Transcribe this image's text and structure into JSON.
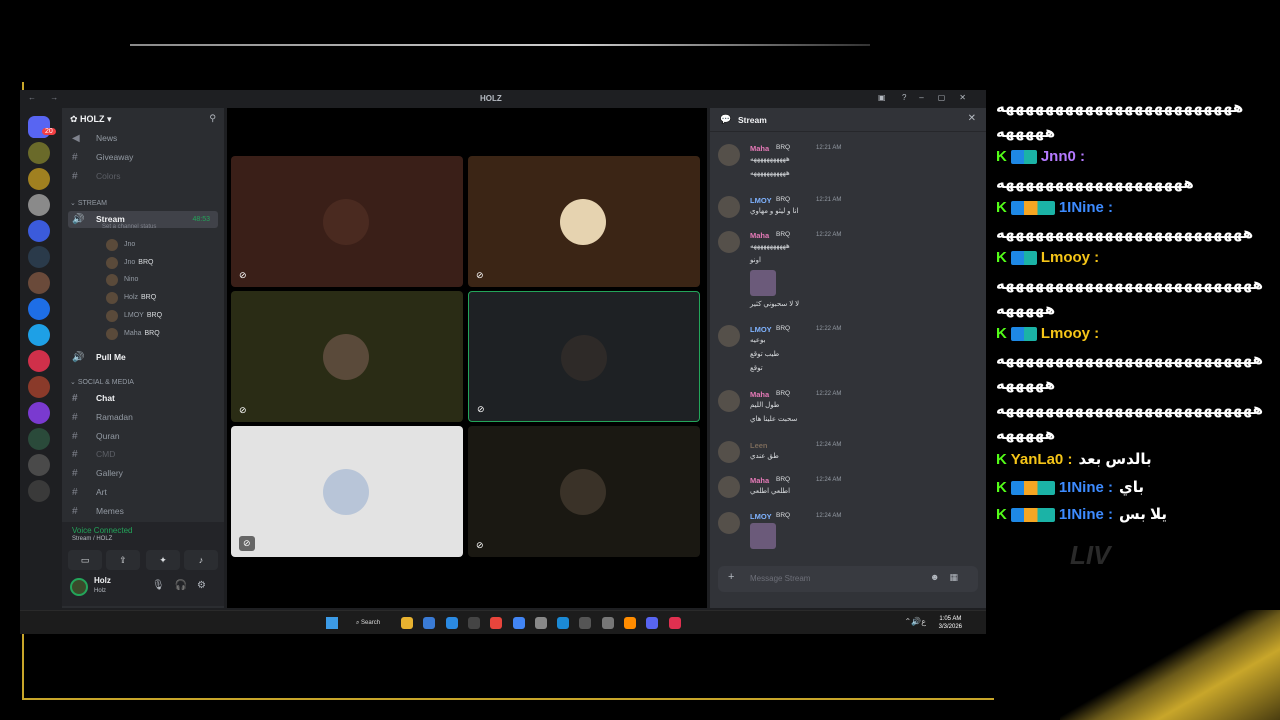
{
  "window": {
    "title": "HOLZ",
    "nav": "← →"
  },
  "server": {
    "name": "HOLZ",
    "mention_badge": "20",
    "rail": [
      {
        "icon": "discord-home-icon",
        "color": "#5865f2"
      },
      {
        "icon": "holz-server-icon",
        "color": "#6a6a2a"
      },
      {
        "icon": "server-2-icon",
        "color": "#a08020"
      },
      {
        "icon": "server-3-icon",
        "color": "#8a8a8a"
      },
      {
        "icon": "server-4-icon",
        "color": "#3b5bdb"
      },
      {
        "icon": "server-5-icon",
        "color": "#2a3a4a"
      },
      {
        "icon": "server-6-icon",
        "color": "#6a4a3a"
      },
      {
        "icon": "server-7-icon",
        "color": "#1e6ee6"
      },
      {
        "icon": "server-8-icon",
        "color": "#1ea0e6"
      },
      {
        "icon": "server-9-icon",
        "color": "#d0304a"
      },
      {
        "icon": "server-10-icon",
        "color": "#8a3a2a"
      },
      {
        "icon": "server-11-icon",
        "color": "#7a3ad0"
      },
      {
        "icon": "server-12-icon",
        "color": "#2a4a3a"
      },
      {
        "icon": "server-13-icon",
        "color": "#4a4a4a"
      },
      {
        "icon": "server-14-icon",
        "color": "#3a3a3a"
      }
    ]
  },
  "channels": {
    "top": [
      {
        "label": "News",
        "kind": "📢"
      },
      {
        "label": "Giveaway",
        "kind": "#"
      },
      {
        "label": "Colors",
        "kind": "#"
      }
    ],
    "stream_category": "STREAM",
    "stream_channel": {
      "label": "Stream",
      "timer": "48:53",
      "status": "Set a channel status"
    },
    "voice_users": [
      {
        "name": "Jno",
        "tag": "",
        "mic": "🎤̸"
      },
      {
        "name": "Jno",
        "tag": "BRQ",
        "mic": "🎤̸"
      },
      {
        "name": "Nino",
        "tag": "",
        "mic": "🎤̸"
      },
      {
        "name": "Holz",
        "tag": "BRQ",
        "mic": ""
      },
      {
        "name": "LMOY",
        "tag": "BRQ",
        "mic": "💗"
      },
      {
        "name": "Maha",
        "tag": "BRQ",
        "mic": "🎤̸"
      }
    ],
    "pull_me": "Pull Me",
    "social_category": "SOCIAL & MEDIA",
    "social": [
      {
        "label": "Chat"
      },
      {
        "label": "Ramadan"
      },
      {
        "label": "Quran"
      },
      {
        "label": "CMD"
      },
      {
        "label": "Gallery"
      },
      {
        "label": "Art"
      },
      {
        "label": "Memes"
      }
    ]
  },
  "voice_connected": {
    "status": "Voice Connected",
    "location": "Stream / HOLZ"
  },
  "user_panel": {
    "name": "Holz",
    "sub": "Holz"
  },
  "tiles": [
    {
      "bg": "#3a1f18",
      "avatar": "#4a2a20"
    },
    {
      "bg": "#3b2515",
      "avatar": "#e6d3b0"
    },
    {
      "bg": "#2a2c15",
      "avatar": "#5a4a3a"
    },
    {
      "bg": "#1e2124",
      "avatar": "#2e2a28"
    },
    {
      "bg": "#e3e3e3",
      "avatar": "#b8c5d8"
    },
    {
      "bg": "#1a1812",
      "avatar": "#3a3228"
    }
  ],
  "chat": {
    "title": "Stream",
    "messages": [
      {
        "name": "Maha",
        "tag": "BRQ",
        "color": "#e67ab8",
        "time": "12:21 AM",
        "lines": [
          "هههههههههههه",
          "هههههههههههه"
        ]
      },
      {
        "name": "LMOY",
        "tag": "BRQ",
        "color": "#7fb3ff",
        "time": "12:21 AM",
        "lines": [
          "انا و ليثو و مهاوي"
        ]
      },
      {
        "name": "Maha",
        "tag": "BRQ",
        "color": "#e67ab8",
        "time": "12:22 AM",
        "lines": [
          "هههههههههههه",
          "اونو",
          "",
          "لا لا سحبوني كثير"
        ]
      },
      {
        "name": "LMOY",
        "tag": "BRQ",
        "color": "#7fb3ff",
        "time": "12:22 AM",
        "lines": [
          "بوعيه",
          "طيب توقع",
          "توقع"
        ]
      },
      {
        "name": "Maha",
        "tag": "BRQ",
        "color": "#e67ab8",
        "time": "12:22 AM",
        "lines": [
          "طول الليم",
          "سحبت علينا هاي"
        ]
      },
      {
        "name": "Leen",
        "tag": "",
        "color": "#7a6a5a",
        "time": "12:24 AM",
        "lines": [
          "طق عندي"
        ]
      },
      {
        "name": "Maha",
        "tag": "BRQ",
        "color": "#e67ab8",
        "time": "12:24 AM",
        "lines": [
          "اطلعي اطلعي"
        ]
      },
      {
        "name": "LMOY",
        "tag": "BRQ",
        "color": "#7fb3ff",
        "time": "12:24 AM",
        "lines": [
          ""
        ]
      }
    ],
    "placeholder": "Message Stream"
  },
  "taskbar": {
    "search": "Search",
    "time": "1:05 AM",
    "date": "3/3/2026"
  },
  "overlay": [
    {
      "text": "ههههههههههههههههههههههههه"
    },
    {
      "text": "هههههه"
    },
    {
      "user": "Jnn0 :",
      "color": "#b57aff",
      "badges": "short"
    },
    {
      "text": "هههههههههههههههههههه"
    },
    {
      "user": "1INine :",
      "color": "#3d8bff",
      "badges": "long"
    },
    {
      "text": "هههههههههههههههههههههههههه"
    },
    {
      "user": "Lmooy :",
      "color": "#f5c518",
      "badges": "short"
    },
    {
      "text": "ههههههههههههههههههههههههههه"
    },
    {
      "text": "هههههه"
    },
    {
      "user": "Lmooy :",
      "color": "#f5c518",
      "badges": "short"
    },
    {
      "text": "ههههههههههههههههههههههههههه"
    },
    {
      "text": "هههههه"
    },
    {
      "text": "ههههههههههههههههههههههههههه"
    },
    {
      "text": "هههههه"
    },
    {
      "user": "YanLa0 :",
      "color": "#f5c518",
      "badges": "none",
      "msg": "بالدس بعد"
    },
    {
      "user": "1INine :",
      "color": "#3d8bff",
      "badges": "long",
      "msg": "باي"
    },
    {
      "user": "1INine :",
      "color": "#3d8bff",
      "badges": "long",
      "msg": "يلا بس"
    }
  ],
  "watermark": "LIV"
}
